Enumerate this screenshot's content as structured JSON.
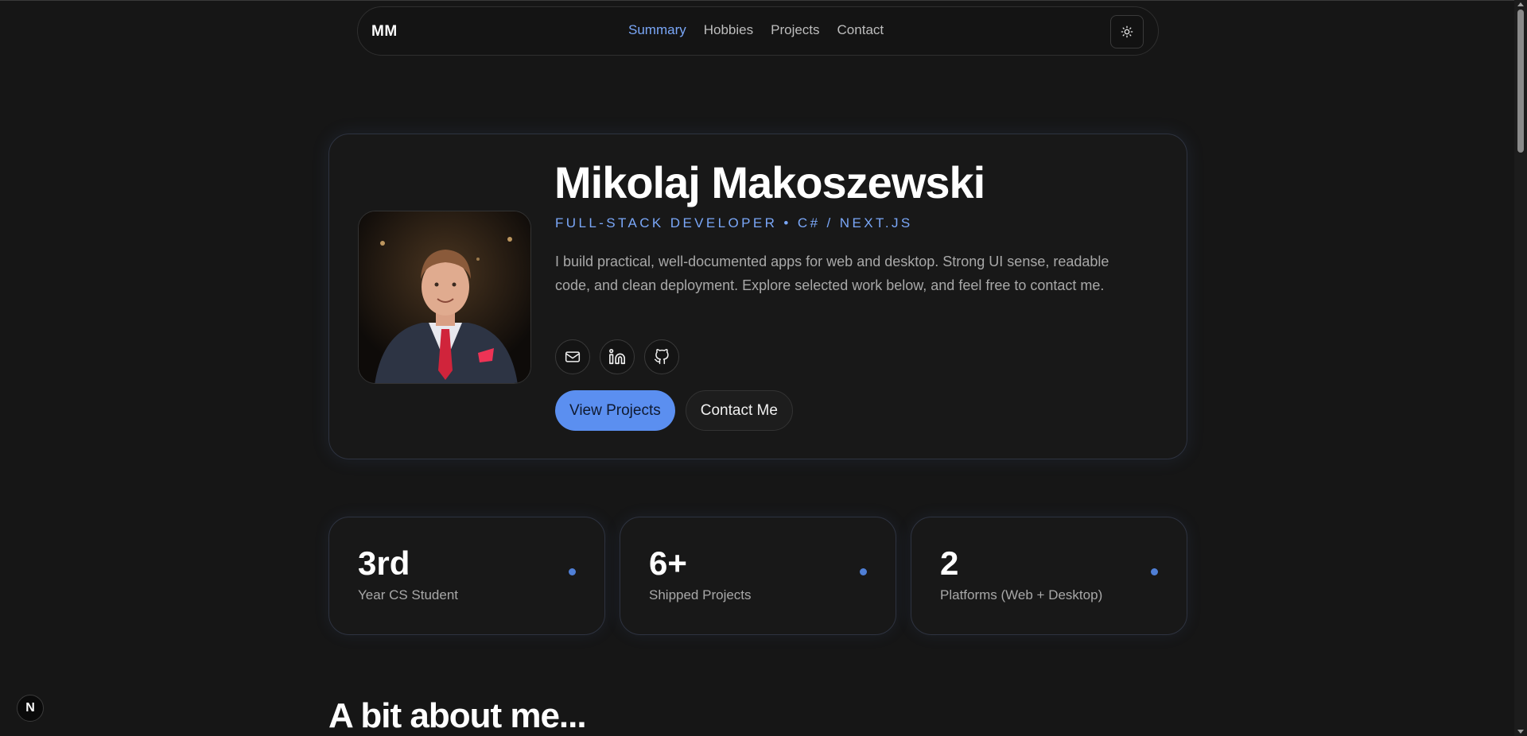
{
  "nav": {
    "logo": "MM",
    "links": [
      "Summary",
      "Hobbies",
      "Projects",
      "Contact"
    ],
    "active_link": "Summary",
    "theme_icon": "sun-icon"
  },
  "hero": {
    "name": "Mikolaj Makoszewski",
    "role": "FULL-STACK DEVELOPER • C# / NEXT.JS",
    "bio": "I build practical, well-documented apps for web and desktop. Strong UI sense, readable code, and clean deployment. Explore selected work below, and feel free to contact me.",
    "socials": [
      "mail-icon",
      "linkedin-icon",
      "github-icon"
    ],
    "primary_button": "View Projects",
    "secondary_button": "Contact Me"
  },
  "stats": [
    {
      "value": "3rd",
      "label": "Year CS Student"
    },
    {
      "value": "6+",
      "label": "Shipped Projects"
    },
    {
      "value": "2",
      "label": "Platforms (Web + Desktop)"
    }
  ],
  "section_title": "A bit about me...",
  "next_badge": "N",
  "colors": {
    "background": "#161616",
    "accent": "#7aa7f8",
    "primary_button": "#5b8ff0",
    "card_border": "#2e3340"
  }
}
